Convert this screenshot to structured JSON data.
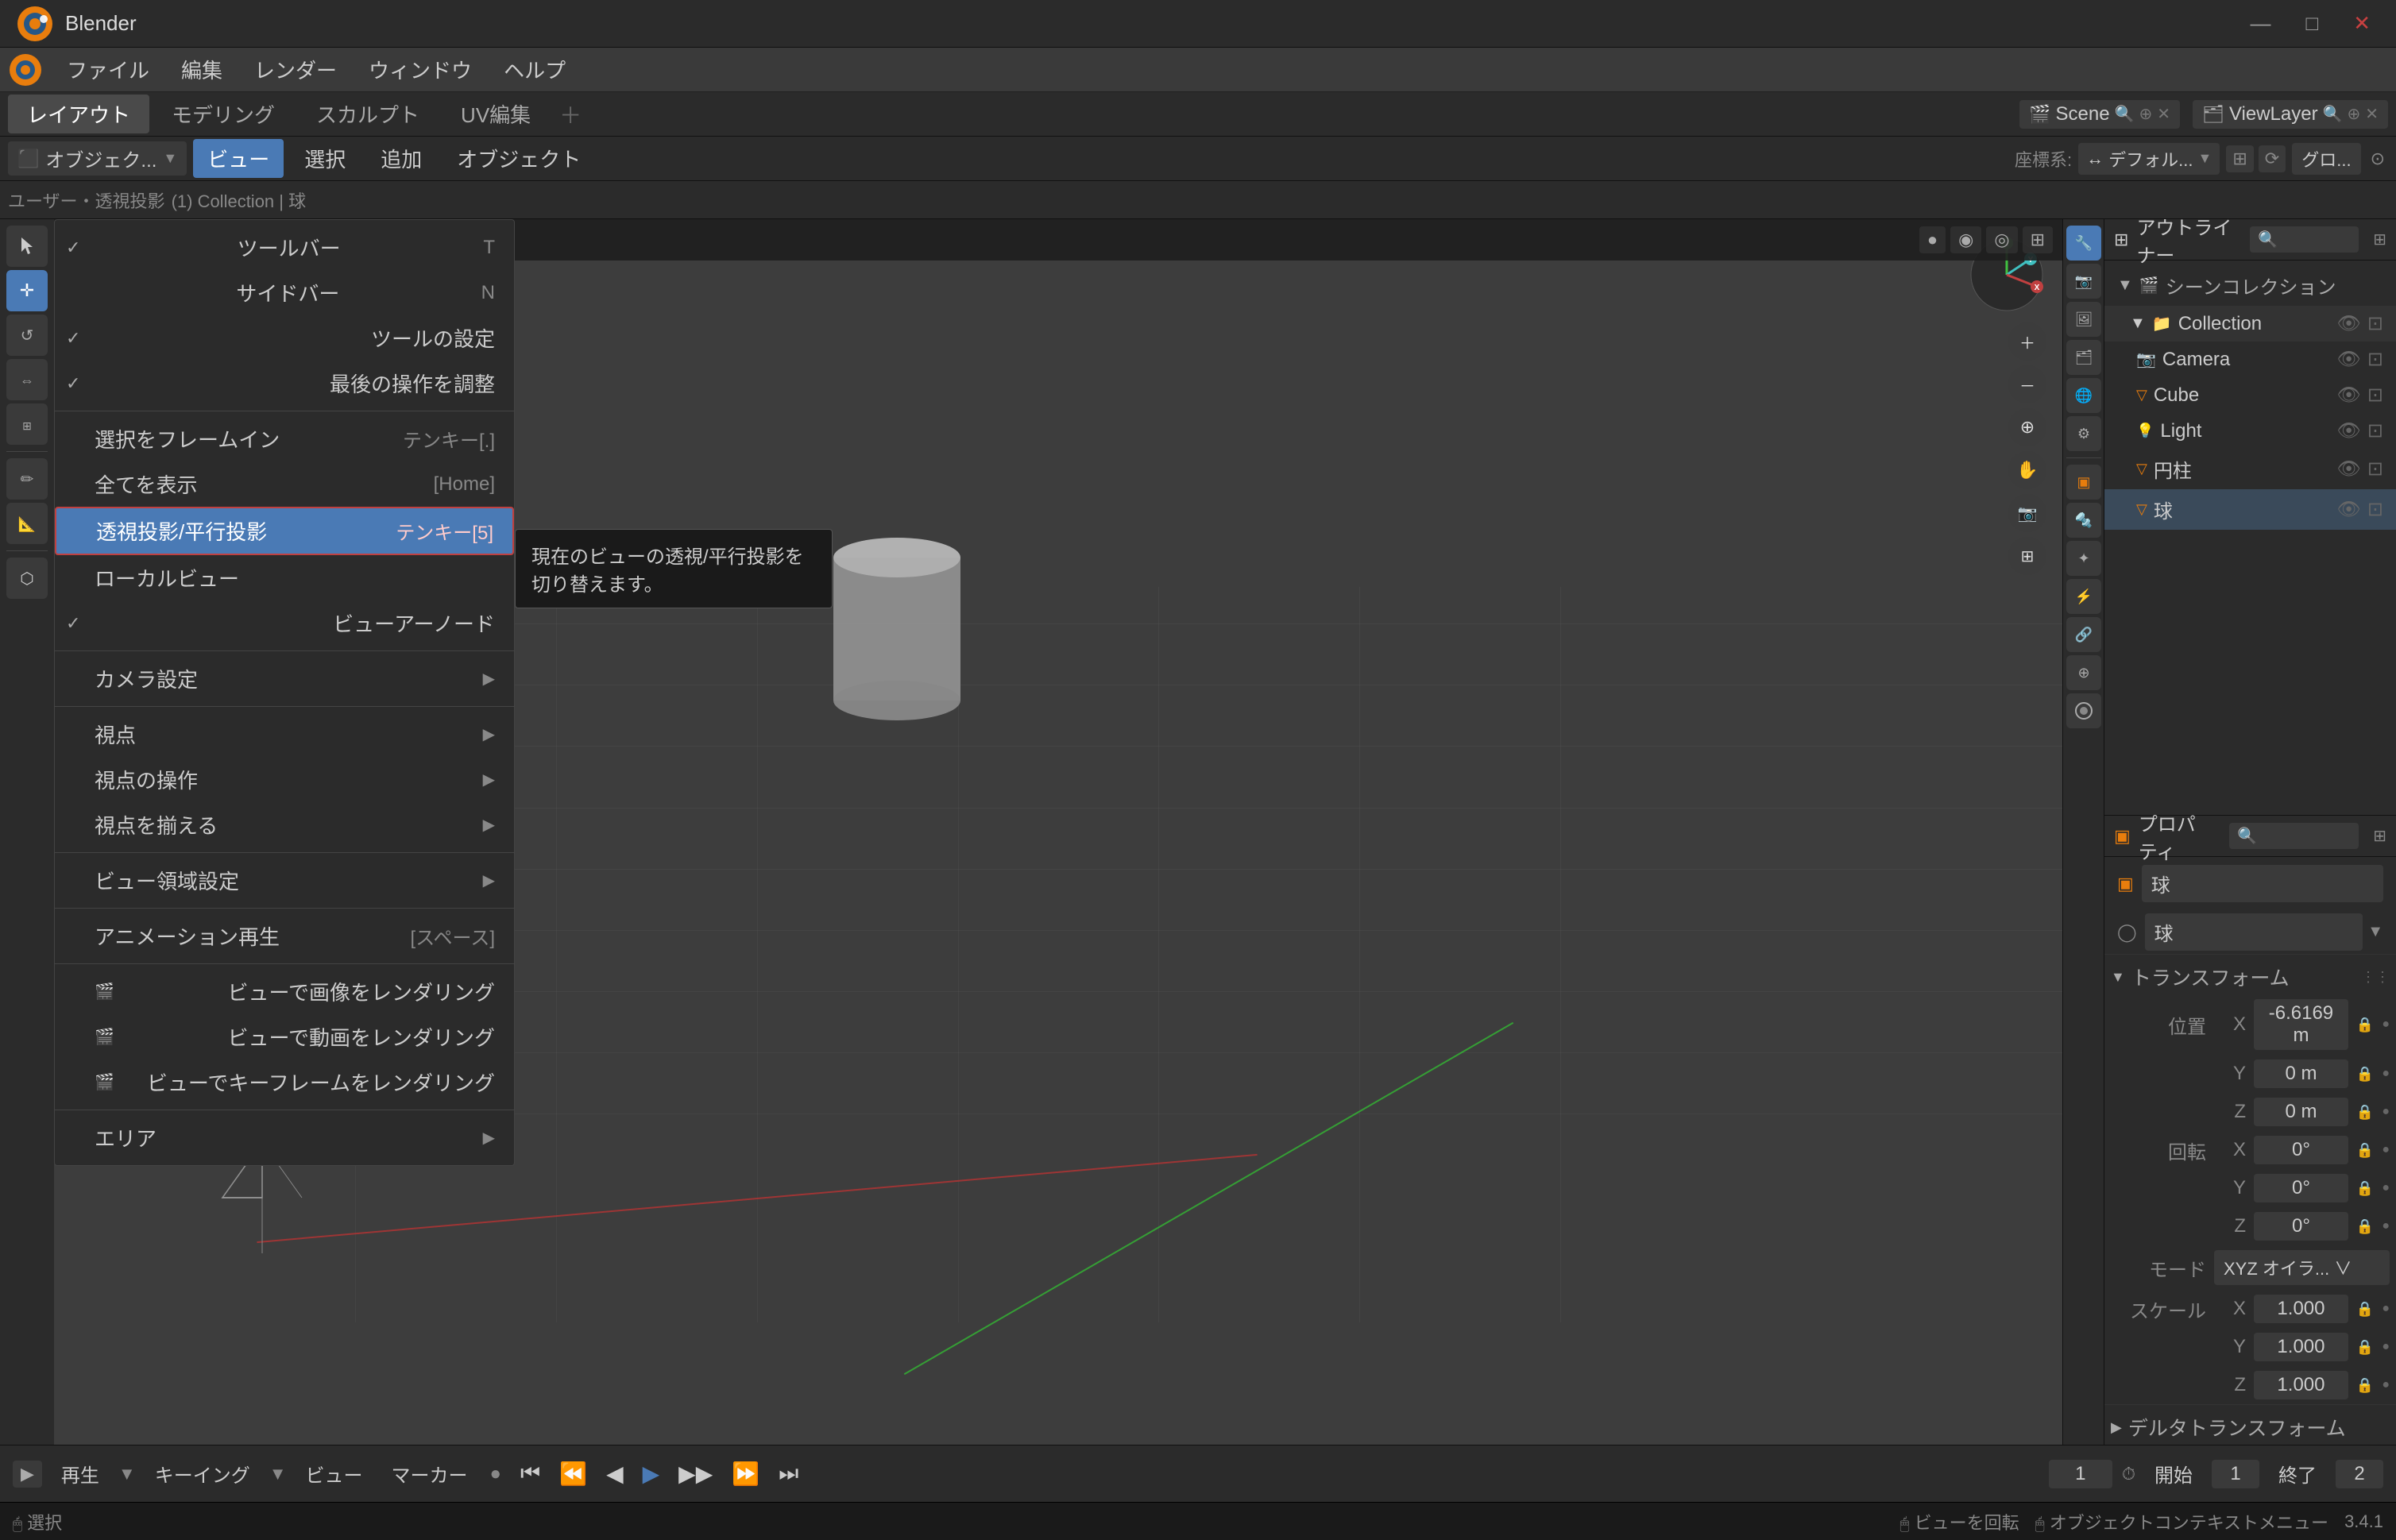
{
  "window": {
    "title": "Blender",
    "version": "3.4.1",
    "controls": [
      "—",
      "□",
      "✕"
    ]
  },
  "menubar": {
    "items": [
      "ファイル",
      "編集",
      "レンダー",
      "ウィンドウ",
      "ヘルプ"
    ]
  },
  "workspace_tabs": {
    "items": [
      "レイアウト",
      "モデリング",
      "スカルプト",
      "UV編集"
    ]
  },
  "scene_selector": {
    "label": "Scene",
    "view_layer": "ViewLayer"
  },
  "header": {
    "coord_label": "座標系:",
    "coord_value": "デフォル...",
    "object_label": "オブジェク...",
    "view_menu": "ビュー",
    "select_menu": "選択",
    "add_menu": "追加",
    "object_menu": "オブジェクト",
    "global_label": "グロ...",
    "selected_object": "(1) Collection | 球",
    "mode_label": "ユーザー・透視投影"
  },
  "view_menu": {
    "items": [
      {
        "id": "toolbar",
        "label": "ツールバー",
        "shortcut": "T",
        "checked": true,
        "has_sub": false
      },
      {
        "id": "sidebar",
        "label": "サイドバー",
        "shortcut": "N",
        "checked": false,
        "has_sub": false
      },
      {
        "id": "tool_settings",
        "label": "ツールの設定",
        "shortcut": "",
        "checked": true,
        "has_sub": false
      },
      {
        "id": "last_op",
        "label": "最後の操作を調整",
        "shortcut": "",
        "checked": true,
        "has_sub": false
      },
      {
        "id": "sep1",
        "type": "separator"
      },
      {
        "id": "frame_selected",
        "label": "選択をフレームイン",
        "shortcut": "テンキー[.]",
        "checked": false,
        "has_sub": false
      },
      {
        "id": "frame_all",
        "label": "全てを表示",
        "shortcut": "[Home]",
        "checked": false,
        "has_sub": false
      },
      {
        "id": "perspective",
        "label": "透視投影/平行投影",
        "shortcut": "テンキー[5]",
        "checked": false,
        "has_sub": false,
        "highlighted": true
      },
      {
        "id": "local_view",
        "label": "ローカルビュー",
        "shortcut": "",
        "checked": false,
        "has_sub": false
      },
      {
        "id": "viewer_node",
        "label": "ビューアーノード",
        "shortcut": "",
        "checked": true,
        "has_sub": false
      },
      {
        "id": "sep2",
        "type": "separator"
      },
      {
        "id": "camera_settings",
        "label": "カメラ設定",
        "shortcut": "",
        "checked": false,
        "has_sub": true
      },
      {
        "id": "sep3",
        "type": "separator"
      },
      {
        "id": "viewpoint",
        "label": "視点",
        "shortcut": "",
        "checked": false,
        "has_sub": true
      },
      {
        "id": "viewpoint_ops",
        "label": "視点の操作",
        "shortcut": "",
        "checked": false,
        "has_sub": true
      },
      {
        "id": "align_view",
        "label": "視点を揃える",
        "shortcut": "",
        "checked": false,
        "has_sub": true
      },
      {
        "id": "sep4",
        "type": "separator"
      },
      {
        "id": "view_region",
        "label": "ビュー領域設定",
        "shortcut": "",
        "checked": false,
        "has_sub": true
      },
      {
        "id": "sep5",
        "type": "separator"
      },
      {
        "id": "play_anim",
        "label": "アニメーション再生",
        "shortcut": "[スペース]",
        "checked": false,
        "has_sub": false
      },
      {
        "id": "sep6",
        "type": "separator"
      },
      {
        "id": "render_img",
        "label": "ビューで画像をレンダリング",
        "shortcut": "",
        "checked": false,
        "has_sub": false,
        "icon": "render"
      },
      {
        "id": "render_vid",
        "label": "ビューで動画をレンダリング",
        "shortcut": "",
        "checked": false,
        "has_sub": false,
        "icon": "render"
      },
      {
        "id": "render_key",
        "label": "ビューでキーフレームをレンダリング",
        "shortcut": "",
        "checked": false,
        "has_sub": false,
        "icon": "render"
      },
      {
        "id": "sep7",
        "type": "separator"
      },
      {
        "id": "area",
        "label": "エリア",
        "shortcut": "",
        "checked": false,
        "has_sub": true
      }
    ]
  },
  "tooltip": {
    "text": "現在のビューの透視/平行投影を切り替えます。"
  },
  "outliner": {
    "title": "シーンコレクション",
    "collection": "Collection",
    "items": [
      {
        "name": "Camera",
        "icon": "📷",
        "type": "camera"
      },
      {
        "name": "Cube",
        "icon": "▽",
        "type": "mesh",
        "color": "orange"
      },
      {
        "name": "Light",
        "icon": "💡",
        "type": "light"
      },
      {
        "name": "円柱",
        "icon": "▽",
        "type": "mesh",
        "color": "orange"
      },
      {
        "name": "球",
        "icon": "▽",
        "type": "mesh",
        "color": "orange"
      }
    ]
  },
  "properties": {
    "object_name": "球",
    "data_name": "球",
    "transform": {
      "label": "トランスフォーム",
      "position": {
        "label": "位置",
        "x": {
          "label": "X",
          "value": "-6.6169 m"
        },
        "y": {
          "label": "Y",
          "value": "0 m"
        },
        "z": {
          "label": "Z",
          "value": "0 m"
        }
      },
      "rotation": {
        "label": "回転",
        "x": {
          "label": "X",
          "value": "0°"
        },
        "y": {
          "label": "Y",
          "value": "0°"
        },
        "z": {
          "label": "Z",
          "value": "0°"
        }
      },
      "mode": {
        "label": "モード",
        "value": "XYZ オイラ... ∨"
      },
      "scale": {
        "label": "スケール",
        "x": {
          "label": "X",
          "value": "1.000"
        },
        "y": {
          "label": "Y",
          "value": "1.000"
        },
        "z": {
          "label": "Z",
          "value": "1.000"
        }
      },
      "delta": {
        "label": "デルタトランスフォーム"
      }
    }
  },
  "timeline": {
    "playback": "再生",
    "keying": "キーイング",
    "view": "ビュー",
    "marker": "マーカー",
    "frame": "1",
    "start": "開始",
    "start_val": "1",
    "end": "終了",
    "end_val": "2"
  },
  "statusbar": {
    "left": "選択",
    "right1": "ビューを回転",
    "right2": "オブジェクトコンテキストメニュー",
    "version": "3.4.1"
  },
  "colors": {
    "accent": "#4a7ab5",
    "bg_dark": "#1a1a1a",
    "bg_medium": "#2b2b2b",
    "bg_light": "#3a3a3a",
    "text_primary": "#cccccc",
    "text_dim": "#888888",
    "highlight": "#4a7ab5",
    "highlight_red": "#b54a4a",
    "x_axis": "#c84040",
    "y_axis": "#40a040",
    "z_axis": "#4040c8"
  }
}
